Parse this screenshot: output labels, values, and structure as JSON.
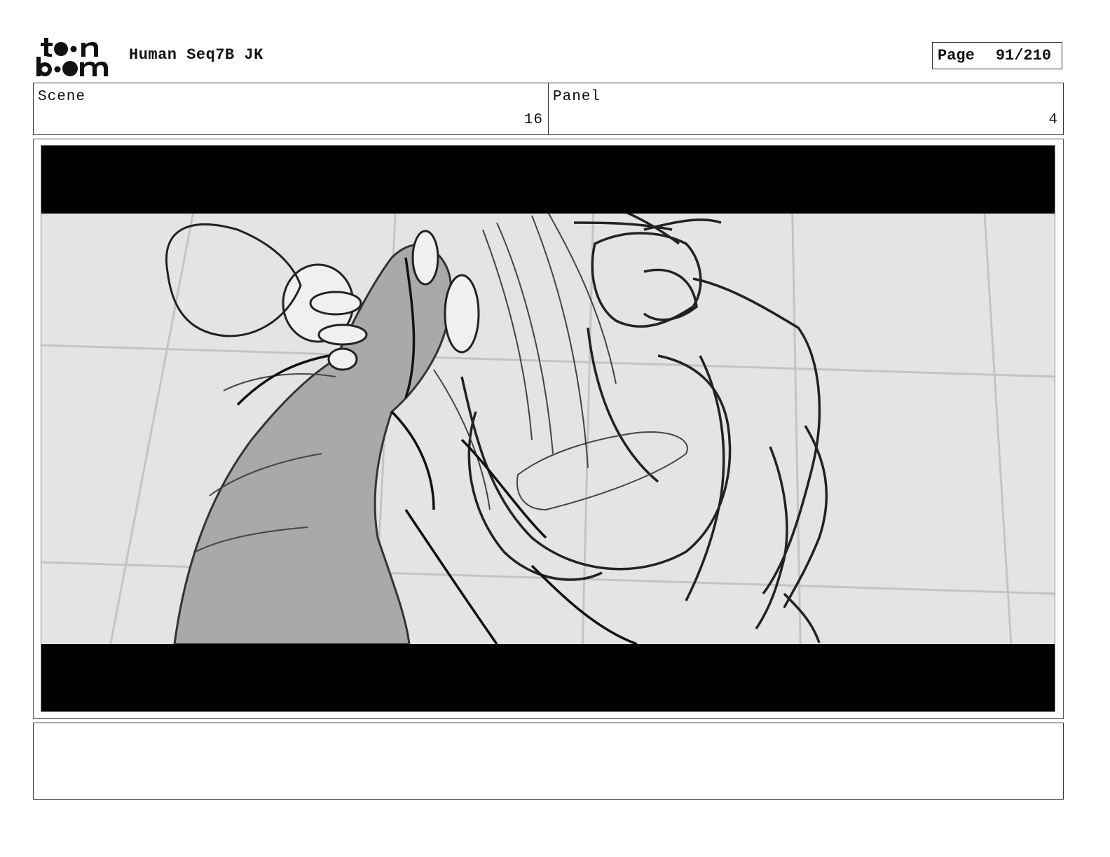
{
  "header": {
    "logo_text": "toon boom",
    "title": "Human Seq7B JK",
    "page_label": "Page",
    "page_number": "91/210"
  },
  "info": {
    "scene_label": "Scene",
    "scene_value": "16",
    "panel_label": "Panel",
    "panel_value": "4"
  },
  "notes": {
    "text": ""
  }
}
